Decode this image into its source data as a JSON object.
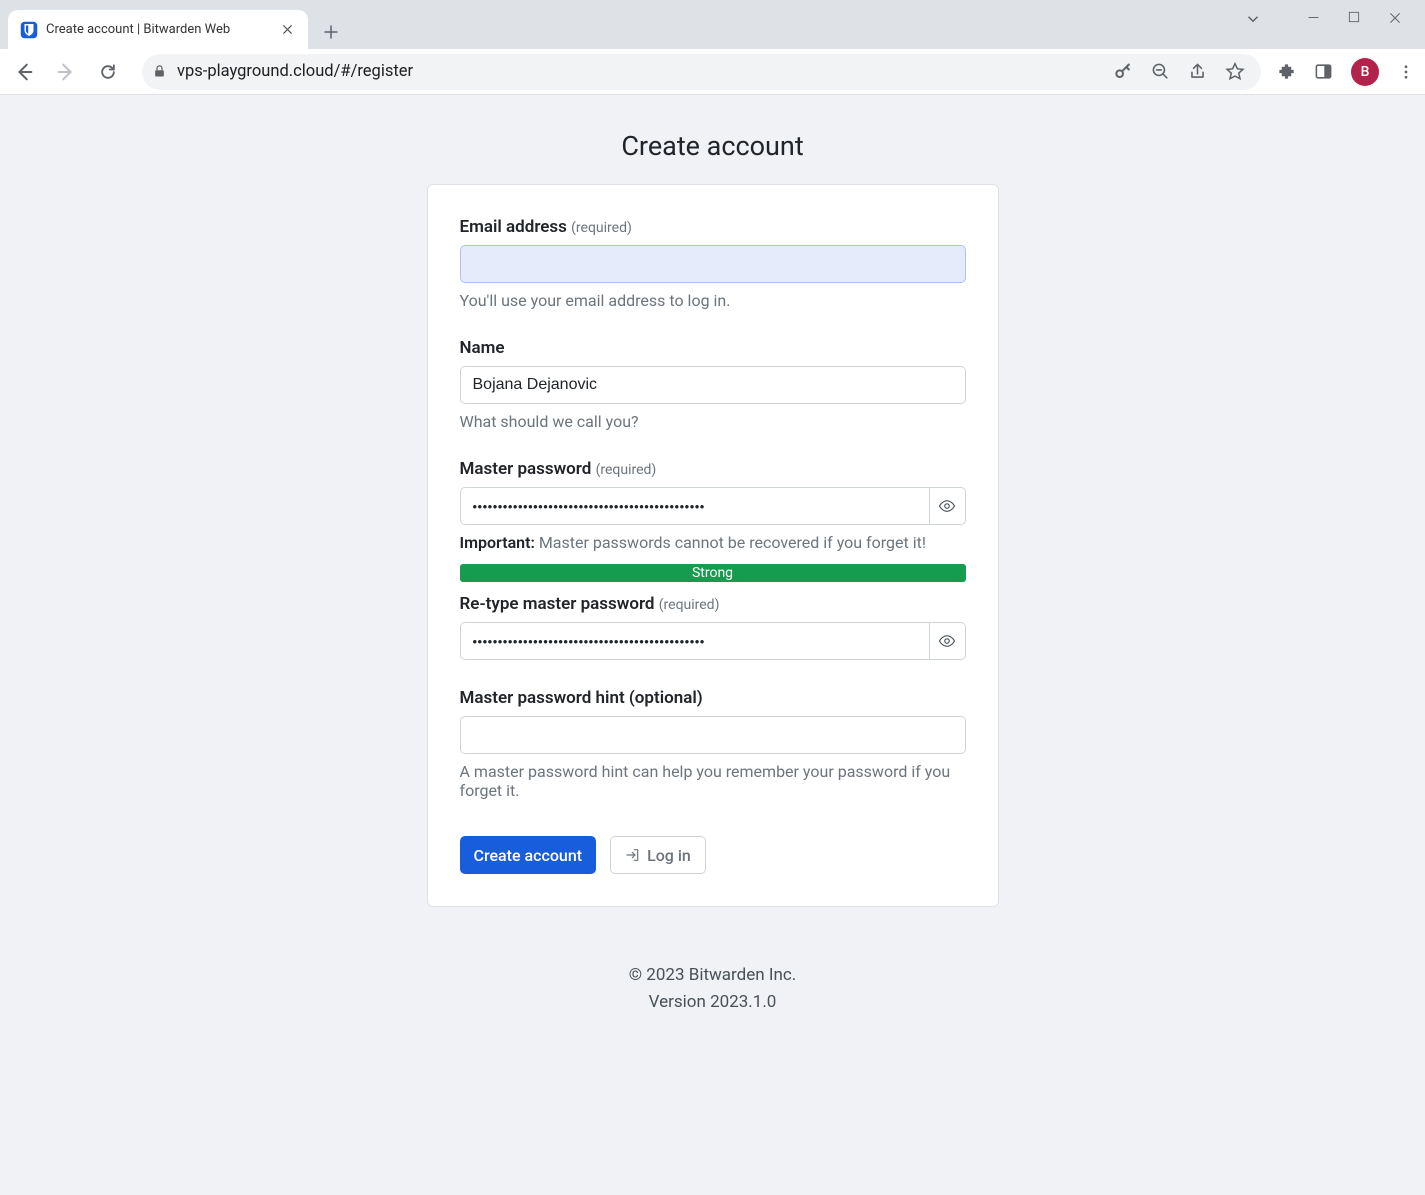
{
  "browser": {
    "tab_title": "Create account | Bitwarden Web",
    "url": "vps-playground.cloud/#/register",
    "profile_initial": "B"
  },
  "page": {
    "title": "Create account",
    "email": {
      "label": "Email address",
      "required": "(required)",
      "value": "",
      "hint": "You'll use your email address to log in."
    },
    "name": {
      "label": "Name",
      "value": "Bojana Dejanovic",
      "hint": "What should we call you?"
    },
    "master_password": {
      "label": "Master password",
      "required": "(required)",
      "value": "••••••••••••••••••••••••••••••••••••••••••••••",
      "hint_strong": "Important:",
      "hint_rest": " Master passwords cannot be recovered if you forget it!"
    },
    "strength": "Strong",
    "retype": {
      "label": "Re-type master password",
      "required": "(required)",
      "value": "••••••••••••••••••••••••••••••••••••••••••••••"
    },
    "pw_hint": {
      "label": "Master password hint (optional)",
      "value": "",
      "hint": "A master password hint can help you remember your password if you forget it."
    },
    "buttons": {
      "create": "Create account",
      "login": "Log in"
    },
    "footer": {
      "copyright": "© 2023 Bitwarden Inc.",
      "version": "Version 2023.1.0"
    }
  }
}
